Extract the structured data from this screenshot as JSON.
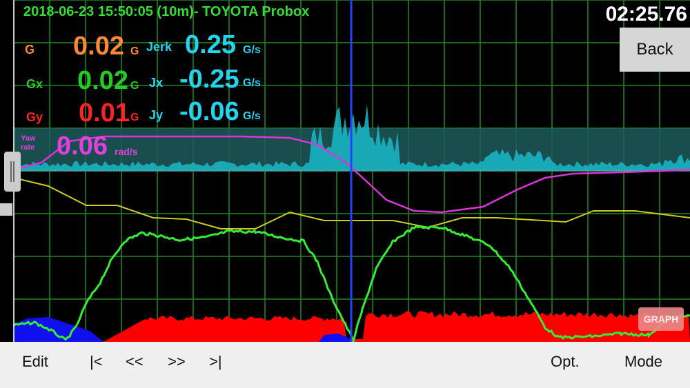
{
  "header": {
    "title": "2018-06-23 15:50:05 (10m)- TOYOTA Probox",
    "timer": "02:25.76",
    "back_label": "Back"
  },
  "readouts": {
    "g": {
      "label": "G",
      "value": "0.02",
      "unit": "G",
      "color": "#ff8833"
    },
    "gx": {
      "label": "Gx",
      "value": "0.02",
      "unit": "G",
      "color": "#22cc22"
    },
    "gy": {
      "label": "Gy",
      "value": "0.01",
      "unit": "G",
      "color": "#ff2222"
    },
    "jerk": {
      "label": "Jerk",
      "value": "0.25",
      "unit": "G/s",
      "color": "#22d4ee"
    },
    "jx": {
      "label": "Jx",
      "value": "-0.25",
      "unit": "G/s",
      "color": "#22d4ee"
    },
    "jy": {
      "label": "Jy",
      "value": "-0.06",
      "unit": "G/s",
      "color": "#22d4ee"
    },
    "yaw": {
      "label_line1": "Yaw",
      "label_line2": "rate",
      "value": "0.06",
      "unit": "rad/s",
      "color": "#e040e0"
    }
  },
  "graph_badge": "GRAPH",
  "toolbar": {
    "edit": "Edit",
    "first": "|<",
    "prev": "<<",
    "next": ">>",
    "last": ">|",
    "opt": "Opt.",
    "mode": "Mode"
  },
  "colors": {
    "grid": "#1f8a1f",
    "cursor": "#2244ff",
    "jerk_fill": "#1ab8c8",
    "gy_fill": "#ff0000",
    "neg_fill": "#1010ee",
    "speed": "#33ee33",
    "yaw": "#dd33dd",
    "other": "#cccc22"
  }
}
